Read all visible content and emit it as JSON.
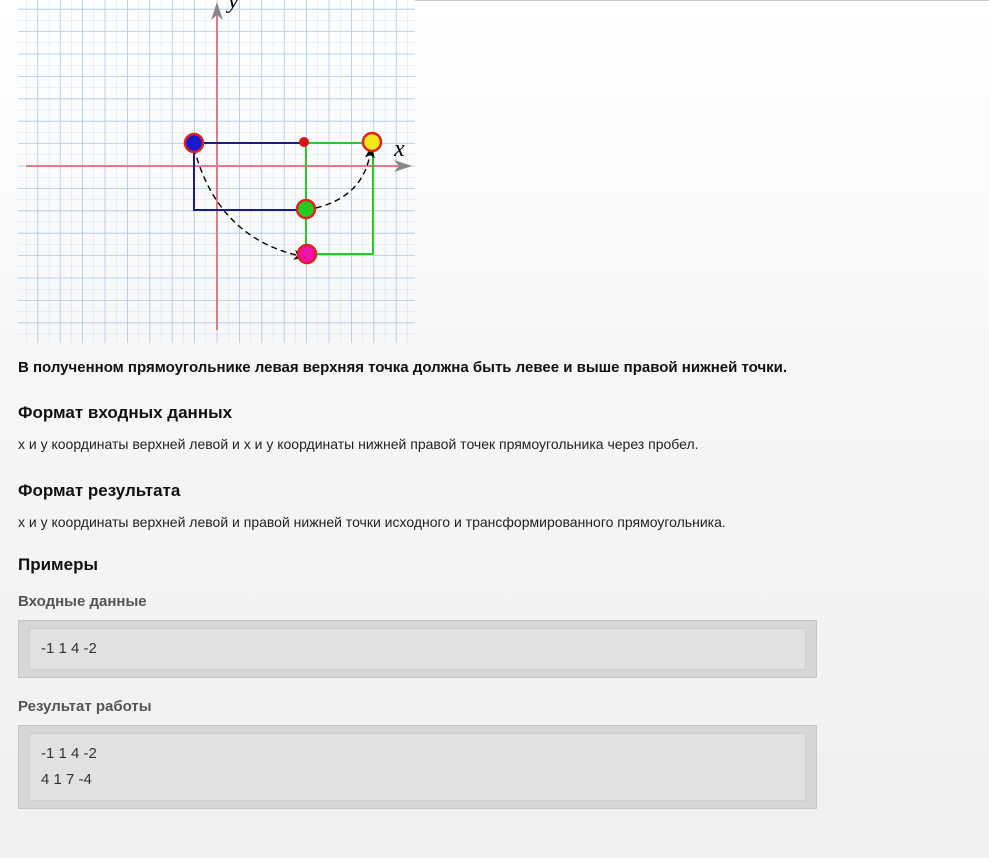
{
  "figure": {
    "axis_x_label": "x",
    "axis_y_label": "y",
    "colors": {
      "grid": "#a8c8e8",
      "axes": "#e07a8a",
      "rect_original": "#1a1a8a",
      "rect_transformed": "#22cc22",
      "point_blue": "#1a1acc",
      "point_red": "#dd1111",
      "point_yellow": "#f2e81a",
      "point_green": "#22cc22",
      "point_magenta": "#ee11aa"
    }
  },
  "note": "В полученном прямоугольнике левая верхняя точка должна быть левее и выше правой нижней точки.",
  "input_format": {
    "title": "Формат входных данных",
    "text": "x и y координаты верхней левой и x и y координаты нижней правой точек прямоугольника через пробел."
  },
  "output_format": {
    "title": "Формат результата",
    "text": "x и y координаты верхней левой и правой нижней точки исходного и трансформированного прямоугольника."
  },
  "examples": {
    "title": "Примеры",
    "input_title": "Входные данные",
    "input_text": "-1 1 4 -2",
    "output_title": "Результат работы",
    "output_text": "-1 1 4 -2\n4 1 7 -4"
  }
}
